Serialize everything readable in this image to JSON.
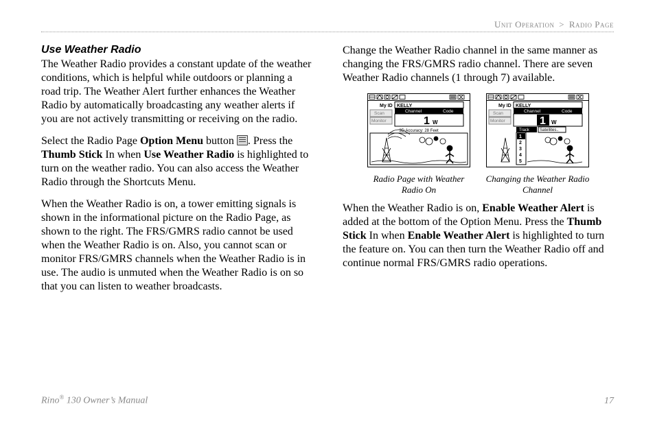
{
  "breadcrumb": {
    "a": "Unit Operation",
    "sep": ">",
    "b": "Radio Page"
  },
  "section_title": "Use Weather Radio",
  "left": {
    "p1": "The Weather Radio provides a constant update of the weather conditions, which is helpful while outdoors or planning a road trip. The Weather Alert further enhances the Weather Radio by automatically broadcasting any weather alerts if you are not actively transmitting or receiving on the radio.",
    "p2a": "Select the Radio Page ",
    "p2b_bold": "Option Menu",
    "p2c": " button ",
    "p2d": ". Press the ",
    "p2e_bold": "Thumb Stick",
    "p2f": " In when ",
    "p2g_bold": "Use Weather Radio",
    "p2h": " is highlighted to turn on the weather radio. You can also access the Weather Radio through the Shortcuts Menu.",
    "p3": "When the Weather Radio is on, a tower emitting signals is shown in the informational picture on the Radio Page, as shown to the right. The FRS/GMRS radio cannot be used when the Weather Radio is on. Also, you cannot scan or monitor FRS/GMRS channels when the Weather Radio is in use. The audio is unmuted when the Weather Radio is on so that you can listen to weather broadcasts."
  },
  "right": {
    "p1": "Change the Weather Radio channel in the same manner as changing the FRS/GMRS radio channel. There are seven Weather Radio channels (1 through 7) available.",
    "p2a": "When the Weather Radio is on, ",
    "p2b_bold": "Enable Weather Alert",
    "p2c": " is added at the bottom of the Option Menu. Press the ",
    "p2d_bold": "Thumb Stick",
    "p2e": " In when ",
    "p2f_bold": "Enable Weather Alert",
    "p2g": " is highlighted to turn the feature on. You can then turn the Weather Radio off and continue normal FRS/GMRS radio operations."
  },
  "figs": {
    "left_caption": "Radio Page with Weather Radio On",
    "right_caption": "Changing the Weather Radio Channel",
    "dev1": {
      "myid_label": "My ID",
      "myid_value": "KELLY",
      "ch_label": "Channel",
      "code_label": "Code",
      "ch_value": "1",
      "wx": "W",
      "scan": "Scan",
      "monitor": "Monitor",
      "accuracy": "3D Accuracy: 28 Feet"
    },
    "dev2": {
      "myid_label": "My ID",
      "myid_value": "KELLY",
      "ch_label": "Channel",
      "code_label": "Code",
      "ch_value": "1",
      "wx": "W",
      "scan": "Scan",
      "monitor": "Monitor",
      "track": "Track",
      "sat": "Satellites..",
      "wx_list": [
        "1",
        "2",
        "3",
        "4",
        "5"
      ]
    }
  },
  "footer": {
    "manual_a": "Rino",
    "manual_b": "®",
    "manual_c": " 130 Owner’s Manual",
    "page": "17"
  }
}
